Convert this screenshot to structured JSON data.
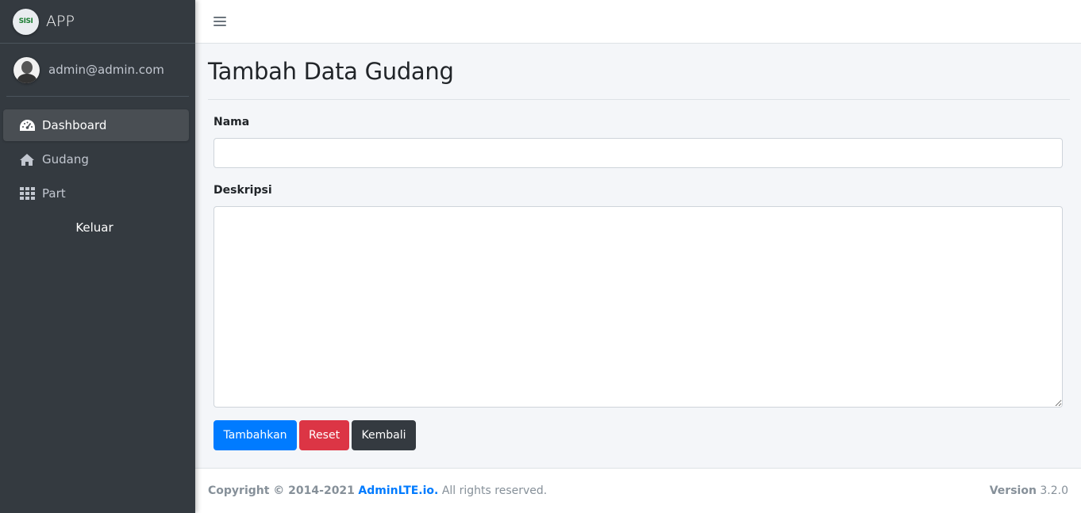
{
  "brand": {
    "logo_text": "SISI",
    "name": "APP"
  },
  "user": {
    "email": "admin@admin.com"
  },
  "sidebar": {
    "items": [
      {
        "label": "Dashboard",
        "icon": "tachometer-icon",
        "active": true
      },
      {
        "label": "Gudang",
        "icon": "home-icon",
        "active": false
      },
      {
        "label": "Part",
        "icon": "grid-icon",
        "active": false
      }
    ],
    "logout_label": "Keluar"
  },
  "topbar": {
    "menu_icon": "hamburger-icon"
  },
  "page": {
    "title": "Tambah Data Gudang"
  },
  "form": {
    "nama_label": "Nama",
    "nama_value": "",
    "deskripsi_label": "Deskripsi",
    "deskripsi_value": "",
    "submit_label": "Tambahkan",
    "reset_label": "Reset",
    "back_label": "Kembali"
  },
  "footer": {
    "copyright_prefix": "Copyright © 2014-2021",
    "brand_link": "AdminLTE.io.",
    "rights": "All rights reserved.",
    "version_label": "Version",
    "version_value": "3.2.0"
  },
  "colors": {
    "sidebar_bg": "#343a40",
    "primary": "#007bff",
    "danger": "#dc3545",
    "dark": "#343a40",
    "content_bg": "#f4f6f9"
  }
}
